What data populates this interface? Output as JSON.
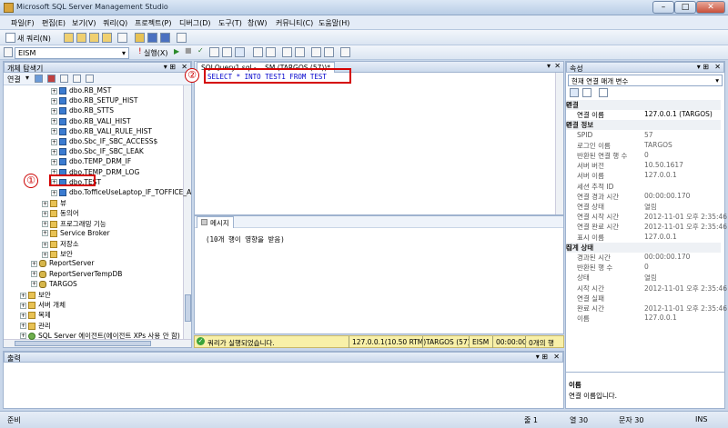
{
  "window": {
    "title": "Microsoft SQL Server Management Studio"
  },
  "menu": [
    "파일(F)",
    "편집(E)",
    "보기(V)",
    "쿼리(Q)",
    "프로젝트(P)",
    "디버그(D)",
    "도구(T)",
    "창(W)",
    "커뮤니티(C)",
    "도움말(H)"
  ],
  "toolbar": {
    "new_query": "새 쿼리(N)",
    "database": "EISM",
    "execute": "실행(X)"
  },
  "object_explorer": {
    "title": "개체 탐색기",
    "connect": "연결",
    "tables": [
      "dbo.RB_MST",
      "dbo.RB_SETUP_HIST",
      "dbo.RB_STTS",
      "dbo.RB_VALI_HIST",
      "dbo.RB_VALI_RULE_HIST",
      "dbo.Sbc_IF_SBC_ACCESS$",
      "dbo.Sbc_IF_SBC_LEAK",
      "dbo.TEMP_DRM_IF",
      "dbo.TEMP_DRM_LOG",
      "dbo.TEST",
      "dbo.TofficeUseLaptop_IF_TOFFICE_A"
    ],
    "folders": [
      "뷰",
      "동의어",
      "프로그래밍 기능",
      "Service Broker",
      "저장소",
      "보안"
    ],
    "databases": [
      "ReportServer",
      "ReportServerTempDB",
      "TARGOS"
    ],
    "root_items": [
      "보안",
      "서버 개체",
      "복제",
      "관리"
    ],
    "agent": "SQL Server 에이전트(에이전트 XPs 사용 안 함)"
  },
  "editor": {
    "tab": "SQLQuery1.sql - ...SM (TARGOS (57))*",
    "query": "SELECT * INTO TEST1 FROM TEST"
  },
  "results": {
    "tab": "메시지",
    "message": "(10개 행이 영향을 받음)"
  },
  "query_status": {
    "message": "쿼리가 실행되었습니다.",
    "server": "127.0.0.1(10.50 RTM)",
    "login": "TARGOS (57)",
    "db": "EISM",
    "time": "00:00:00",
    "rows": "0개의 행"
  },
  "output": {
    "title": "출력"
  },
  "properties": {
    "title": "속성",
    "selector": "현재 연결 매개 변수",
    "rows": [
      {
        "type": "cat",
        "name": "연결"
      },
      {
        "type": "row",
        "name": "연결 이름",
        "value": "127.0.0.1 (TARGOS)",
        "dark": true
      },
      {
        "type": "cat",
        "name": "연결 정보"
      },
      {
        "type": "row",
        "name": "SPID",
        "value": "57"
      },
      {
        "type": "row",
        "name": "로그인 이름",
        "value": "TARGOS"
      },
      {
        "type": "row",
        "name": "반환된 연결 행 수",
        "value": "0"
      },
      {
        "type": "row",
        "name": "서버 버전",
        "value": "10.50.1617"
      },
      {
        "type": "row",
        "name": "서버 이름",
        "value": "127.0.0.1"
      },
      {
        "type": "row",
        "name": "세션 추적 ID",
        "value": ""
      },
      {
        "type": "row",
        "name": "연결 경과 시간",
        "value": "00:00:00.170"
      },
      {
        "type": "row",
        "name": "연결 상태",
        "value": "열림"
      },
      {
        "type": "row",
        "name": "연결 시작 시간",
        "value": "2012-11-01 오후 2:35:46"
      },
      {
        "type": "row",
        "name": "연결 완료 시간",
        "value": "2012-11-01 오후 2:35:46"
      },
      {
        "type": "row",
        "name": "표시 이름",
        "value": "127.0.0.1"
      },
      {
        "type": "cat",
        "name": "집계 상태"
      },
      {
        "type": "row",
        "name": "경과된 시간",
        "value": "00:00:00.170"
      },
      {
        "type": "row",
        "name": "반환된 행 수",
        "value": "0"
      },
      {
        "type": "row",
        "name": "상태",
        "value": "열림"
      },
      {
        "type": "row",
        "name": "시작 시간",
        "value": "2012-11-01 오후 2:35:46"
      },
      {
        "type": "row",
        "name": "연결 실패",
        "value": ""
      },
      {
        "type": "row",
        "name": "완료 시간",
        "value": "2012-11-01 오후 2:35:46"
      },
      {
        "type": "row",
        "name": "이름",
        "value": "127.0.0.1"
      }
    ],
    "desc_title": "이름",
    "desc_text": "연결 이름입니다."
  },
  "statusbar": {
    "ready": "준비",
    "line": "줄 1",
    "col": "열 30",
    "ch": "문자 30",
    "ins": "INS"
  },
  "annotations": {
    "one": "①",
    "two": "②"
  }
}
